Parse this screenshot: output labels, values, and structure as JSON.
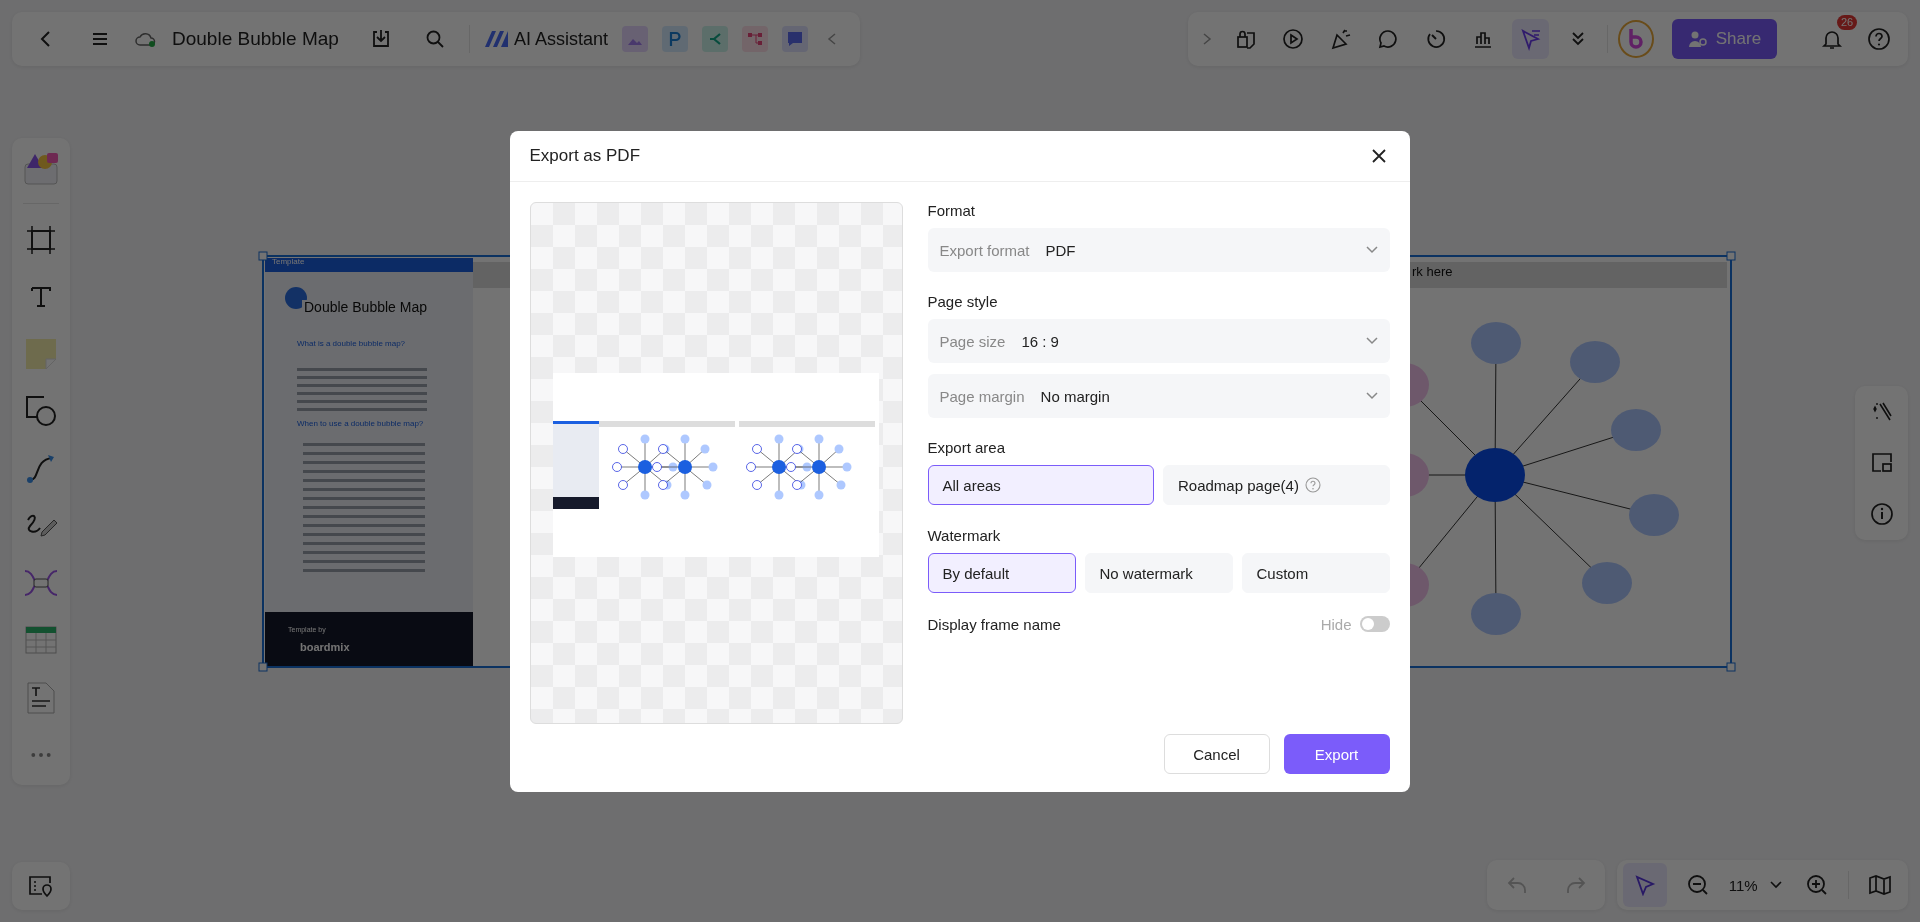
{
  "topbar": {
    "title": "Double Bubble Map",
    "ai_label": "AI Assistant",
    "share": "Share",
    "notification_count": "26"
  },
  "canvas": {
    "frame_label": "Template",
    "doc_title": "Double Bubble Map",
    "heading_1": "What is a double bubble map?",
    "heading_2": "When to use a double bubble map?",
    "footer_label": "Template by",
    "footer_brand": "boardmix",
    "frame_2_title": "rk here"
  },
  "dialog": {
    "title": "Export as PDF",
    "sections": [
      {
        "kind": "select",
        "title": "Format",
        "fields": [
          {
            "label": "Export format",
            "value": "PDF"
          }
        ]
      },
      {
        "kind": "select",
        "title": "Page style",
        "fields": [
          {
            "label": "Page size",
            "value": "16 : 9"
          },
          {
            "label": "Page margin",
            "value": "No margin"
          }
        ]
      },
      {
        "kind": "options",
        "title": "Export area",
        "options": [
          {
            "label": "All areas",
            "selected": true,
            "help": false
          },
          {
            "label": "Roadmap page(4)",
            "selected": false,
            "help": true
          }
        ]
      },
      {
        "kind": "options",
        "title": "Watermark",
        "options": [
          {
            "label": "By default",
            "selected": true,
            "help": false
          },
          {
            "label": "No watermark",
            "selected": false,
            "help": false
          },
          {
            "label": "Custom",
            "selected": false,
            "help": false
          }
        ]
      },
      {
        "kind": "toggle",
        "title": "Display frame name",
        "state_label": "Hide",
        "on": false
      }
    ],
    "cancel": "Cancel",
    "confirm": "Export"
  },
  "zoom": {
    "level_text": "11%"
  }
}
